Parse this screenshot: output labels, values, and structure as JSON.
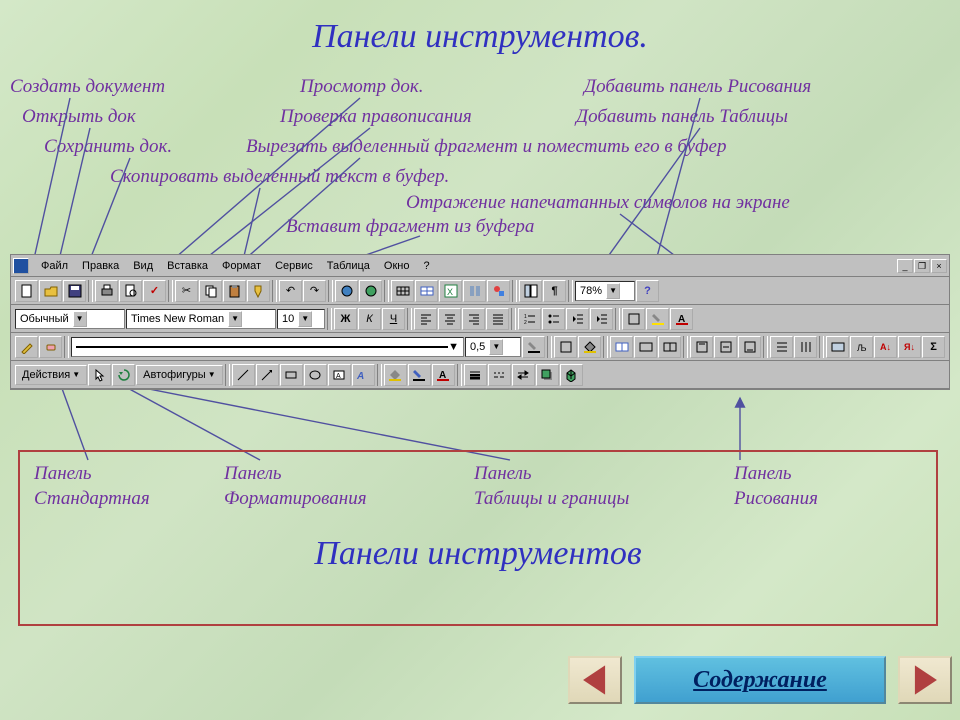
{
  "title": "Панели инструментов.",
  "annotations": {
    "create": "Создать документ",
    "open": "Открыть док",
    "save": "Сохранить док.",
    "copy": "Скопировать выделенный текст в буфер.",
    "preview": "Просмотр док.",
    "spell": "Проверка правописания",
    "cut": "Вырезать выделенный фрагмент и поместить его в буфер",
    "paste": "Вставит фрагмент из буфера",
    "showmarks": "Отражение напечатанных символов на экране",
    "adddraw": "Добавить панель Рисования",
    "addtable": "Добавить панель Таблицы"
  },
  "menu": [
    "Файл",
    "Правка",
    "Вид",
    "Вставка",
    "Формат",
    "Сервис",
    "Таблица",
    "Окно",
    "?"
  ],
  "standard": {
    "zoom": "78%"
  },
  "format": {
    "style": "Обычный",
    "font": "Times New Roman",
    "size": "10",
    "bold": "Ж",
    "italic": "К",
    "underline": "Ч"
  },
  "tables": {
    "linewidth": "0,5"
  },
  "drawing": {
    "actions": "Действия",
    "autoshapes": "Автофигуры"
  },
  "legend": {
    "c1a": "Панель",
    "c1b": "Стандартная",
    "c2a": "Панель",
    "c2b": "Форматирования",
    "c3a": "Панель",
    "c3b": "Таблицы и границы",
    "c4a": "Панель",
    "c4b": "Рисования",
    "title": "Панели инструментов"
  },
  "nav": {
    "contents": "Содержание"
  }
}
